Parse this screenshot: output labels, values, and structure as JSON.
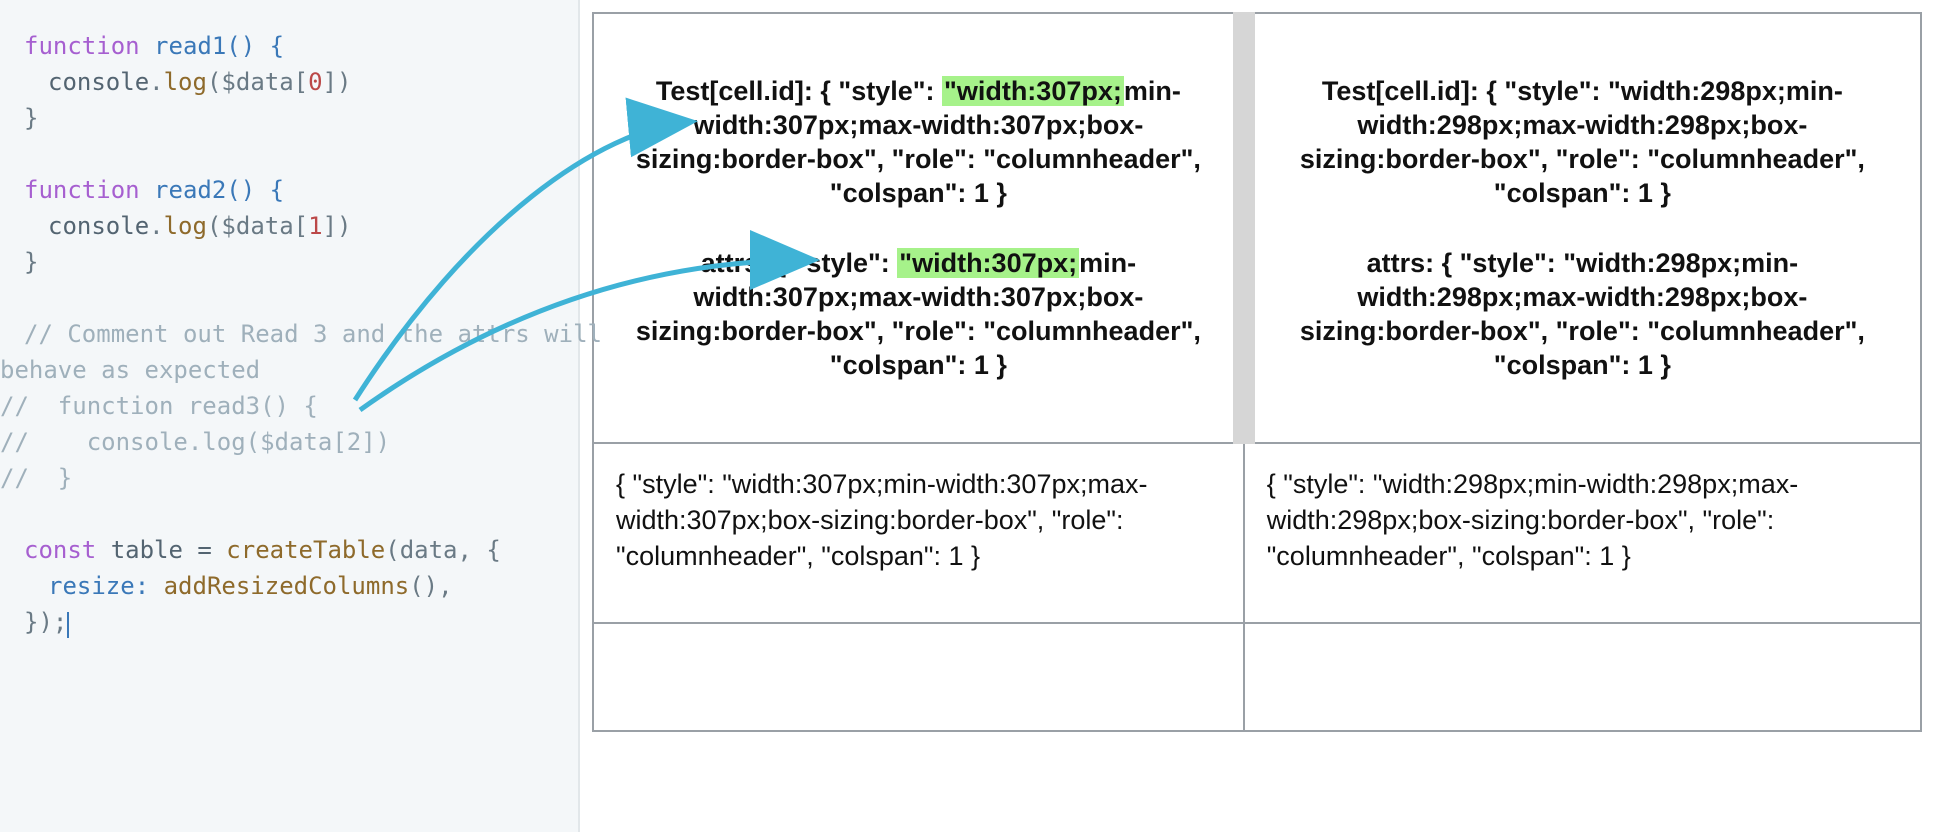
{
  "code": {
    "l1_kw": "function",
    "l1_name": " read1() {",
    "l2_a": "console",
    "l2_b": ".",
    "l2_c": "log",
    "l2_d": "($data[",
    "l2_e": "0",
    "l2_f": "])",
    "l3": "}",
    "l5_kw": "function",
    "l5_name": " read2() {",
    "l6_a": "console",
    "l6_b": ".",
    "l6_c": "log",
    "l6_d": "($data[",
    "l6_e": "1",
    "l6_f": "])",
    "l7": "}",
    "c1": "// Comment out Read 3 and the attrs will ",
    "c1b": "behave as expected",
    "c2": "//  function read3() {",
    "c3": "//    console.log($data[2])",
    "c4": "//  }",
    "l9_kw": "const",
    "l9_a": " table = ",
    "l9_call": "createTable",
    "l9_b": "(data, {",
    "l10_a": "resize: ",
    "l10_call": "addResizedColumns",
    "l10_b": "(),",
    "l11": "});"
  },
  "table": {
    "col1": {
      "h1_a": "Test[cell.id]: { \"style\": ",
      "h1_hl": "\"width:307px;",
      "h1_b": "min-width:307px;max-width:307px;box-sizing:border-box\", \"role\": \"columnheader\", \"colspan\": 1 }",
      "h2_a": "attrs: { \"style\": ",
      "h2_hl": "\"width:307px;",
      "h2_b": "min-width:307px;max-width:307px;box-sizing:border-box\", \"role\": \"columnheader\", \"colspan\": 1 }",
      "cell": "{ \"style\": \"width:307px;min-width:307px;max-width:307px;box-sizing:border-box\", \"role\": \"columnheader\", \"colspan\": 1 }"
    },
    "col2": {
      "h1": "Test[cell.id]: { \"style\": \"width:298px;min-width:298px;max-width:298px;box-sizing:border-box\", \"role\": \"columnheader\", \"colspan\": 1 }",
      "h2": "attrs: { \"style\": \"width:298px;min-width:298px;max-width:298px;box-sizing:border-box\", \"role\": \"columnheader\", \"colspan\": 1 }",
      "cell": "{ \"style\": \"width:298px;min-width:298px;max-width:298px;box-sizing:border-box\", \"role\": \"columnheader\", \"colspan\": 1 }"
    }
  }
}
